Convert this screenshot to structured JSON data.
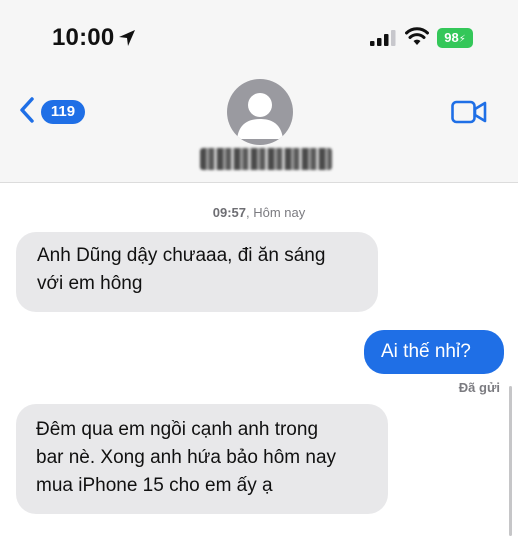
{
  "status_bar": {
    "time": "10:00",
    "battery": "98"
  },
  "header": {
    "back_count": "119",
    "icons": [
      "location-arrow-icon",
      "signal-icon",
      "wifi-icon",
      "battery-icon",
      "chevron-left-icon",
      "avatar-icon",
      "video-camera-icon"
    ]
  },
  "conversation": {
    "timestamp_time": "09:57",
    "timestamp_day": "Hôm nay",
    "messages": [
      {
        "direction": "incoming",
        "lines": [
          "Anh Dũng dậy chưaaa, đi ăn sáng",
          "với em hông"
        ]
      },
      {
        "direction": "outgoing",
        "lines": [
          "Ai thế nhỉ?"
        ]
      },
      {
        "direction": "incoming",
        "lines": [
          "Đêm qua em ngồi cạnh anh trong",
          "bar nè. Xong anh hứa bảo hôm nay",
          "mua iPhone 15 cho em ấy ạ"
        ]
      }
    ],
    "delivered_label": "Đã gửi"
  },
  "colors": {
    "outgoing_bubble": "#1f6fe6",
    "incoming_bubble": "#e8e8ea",
    "battery": "#34c759",
    "header_bg": "#f6f6f6"
  }
}
